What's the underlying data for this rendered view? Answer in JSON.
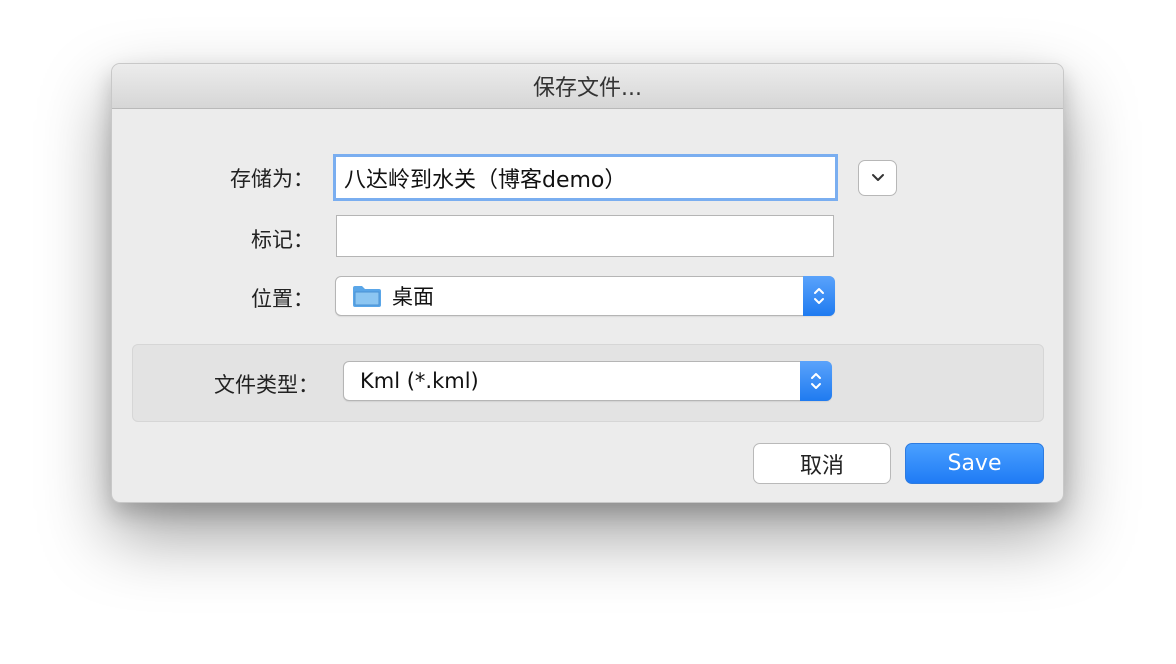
{
  "dialog": {
    "title": "保存文件..."
  },
  "form": {
    "save_as_label": "存储为：",
    "save_as_value": "八达岭到水关（博客demo）",
    "tags_label": "标记：",
    "tags_value": "",
    "location_label": "位置：",
    "location_value": "桌面",
    "location_icon": "folder-icon",
    "filetype_label": "文件类型：",
    "filetype_value": "Kml (*.kml)"
  },
  "buttons": {
    "cancel_label": "取消",
    "save_label": "Save"
  },
  "colors": {
    "accent": "#1f7bf5",
    "focus_ring": "#7aaef0",
    "folder": "#5aa6e8"
  }
}
